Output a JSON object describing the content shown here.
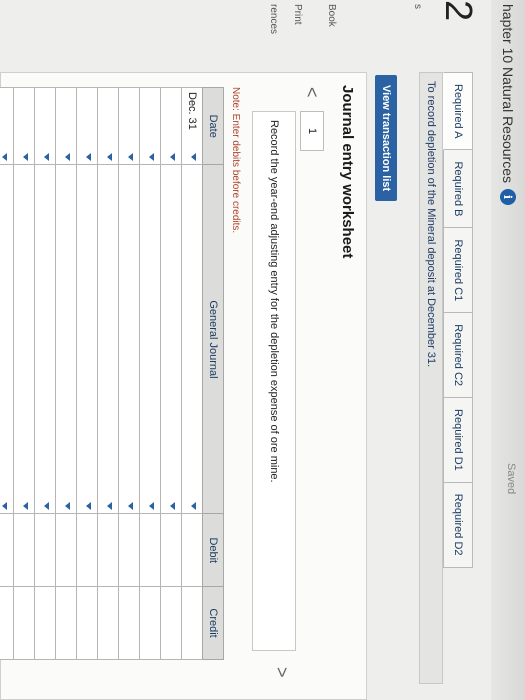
{
  "header": {
    "title": "hapter 10 Natural Resources",
    "saved_text": "Saved",
    "question_number": "2",
    "side_labels": [
      "s",
      "Book",
      "Print",
      "rences"
    ]
  },
  "tabs": [
    {
      "label": "Required A",
      "active": true
    },
    {
      "label": "Required B",
      "active": false
    },
    {
      "label": "Required C1",
      "active": false
    },
    {
      "label": "Required C2",
      "active": false
    },
    {
      "label": "Required D1",
      "active": false
    },
    {
      "label": "Required D2",
      "active": false
    }
  ],
  "instruction": "To record depletion of the Mineral deposit at December 31.",
  "view_button": "View transaction list",
  "worksheet": {
    "title": "Journal entry worksheet",
    "page": "1",
    "prev": "<",
    "next": ">",
    "entry_text": "Record the year-end adjusting entry for the depletion expense of ore mine.",
    "note": "Note: Enter debits before credits."
  },
  "journal": {
    "headers": {
      "date": "Date",
      "general_journal": "General Journal",
      "debit": "Debit",
      "credit": "Credit"
    },
    "rows": [
      {
        "date": "Dec. 31",
        "account": "",
        "debit": "",
        "credit": ""
      },
      {
        "date": "",
        "account": "",
        "debit": "",
        "credit": ""
      },
      {
        "date": "",
        "account": "",
        "debit": "",
        "credit": ""
      },
      {
        "date": "",
        "account": "",
        "debit": "",
        "credit": ""
      },
      {
        "date": "",
        "account": "",
        "debit": "",
        "credit": ""
      },
      {
        "date": "",
        "account": "",
        "debit": "",
        "credit": ""
      },
      {
        "date": "",
        "account": "",
        "debit": "",
        "credit": ""
      },
      {
        "date": "",
        "account": "",
        "debit": "",
        "credit": ""
      },
      {
        "date": "",
        "account": "",
        "debit": "",
        "credit": ""
      },
      {
        "date": "",
        "account": "",
        "debit": "",
        "credit": ""
      },
      {
        "date": "",
        "account": "",
        "debit": "",
        "credit": ""
      }
    ]
  },
  "colors": {
    "accent": "#2a62a3",
    "tab_text": "#1d3c63",
    "note": "#b0432a"
  }
}
